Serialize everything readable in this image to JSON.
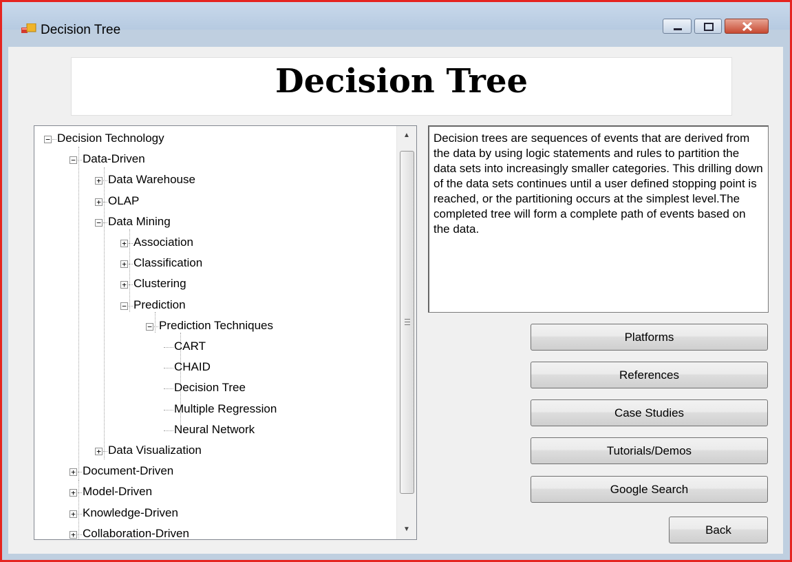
{
  "window": {
    "title": "Decision Tree",
    "controls": [
      "minimize-icon",
      "maximize-icon",
      "close-icon"
    ],
    "accent_border": "#e52420"
  },
  "header": {
    "title": "Decision Tree"
  },
  "tree": {
    "nodes": [
      {
        "label": "Decision Technology",
        "state": "expanded"
      },
      {
        "label": "Data-Driven",
        "state": "expanded"
      },
      {
        "label": "Data Warehouse",
        "state": "collapsed"
      },
      {
        "label": "OLAP",
        "state": "collapsed"
      },
      {
        "label": "Data Mining",
        "state": "expanded"
      },
      {
        "label": "Association",
        "state": "collapsed"
      },
      {
        "label": "Classification",
        "state": "collapsed"
      },
      {
        "label": "Clustering",
        "state": "collapsed"
      },
      {
        "label": "Prediction",
        "state": "expanded"
      },
      {
        "label": "Prediction Techniques",
        "state": "expanded"
      },
      {
        "label": "CART",
        "state": "leaf"
      },
      {
        "label": "CHAID",
        "state": "leaf"
      },
      {
        "label": "Decision Tree",
        "state": "leaf"
      },
      {
        "label": "Multiple Regression",
        "state": "leaf"
      },
      {
        "label": "Neural Network",
        "state": "leaf"
      },
      {
        "label": "Data Visualization",
        "state": "collapsed"
      },
      {
        "label": "Document-Driven",
        "state": "collapsed"
      },
      {
        "label": "Model-Driven",
        "state": "collapsed"
      },
      {
        "label": "Knowledge-Driven",
        "state": "collapsed"
      },
      {
        "label": "Collaboration-Driven",
        "state": "collapsed"
      }
    ]
  },
  "description": {
    "text": "Decision trees are sequences of events that are derived from the data by using logic statements and rules to partition the data sets into increasingly smaller categories. This drilling down of the data sets continues until a user defined stopping point is reached, or the partitioning occurs at the simplest level.The completed tree will form a complete path of events based on the data."
  },
  "buttons": {
    "platforms": "Platforms",
    "references": "References",
    "case_studies": "Case Studies",
    "tutorials": "Tutorials/Demos",
    "google": "Google Search",
    "back": "Back"
  }
}
